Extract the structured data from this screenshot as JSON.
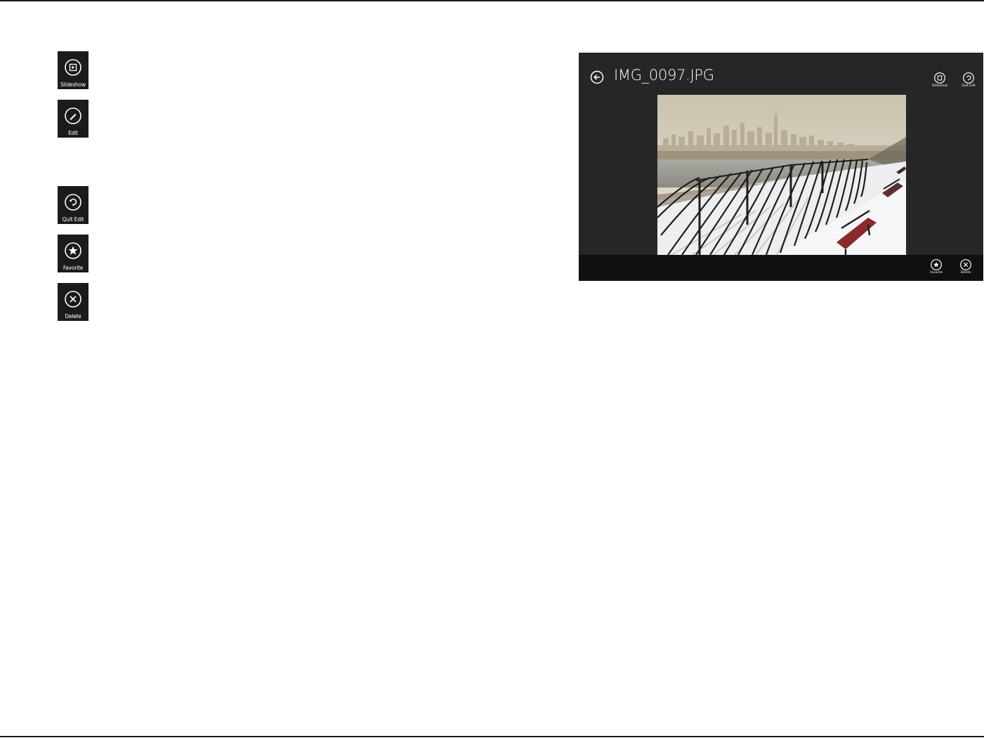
{
  "legend": [
    {
      "icon": "slideshow-icon",
      "label": "Slideshow"
    },
    {
      "icon": "edit-icon",
      "label": "Edit"
    },
    {
      "icon": "quit-edit-icon",
      "label": "Quit Edit"
    },
    {
      "icon": "favorite-icon",
      "label": "Favorite"
    },
    {
      "icon": "delete-icon",
      "label": "Delete"
    }
  ],
  "app": {
    "title": "IMG_0097.JPG",
    "top_buttons": [
      "Slideshow",
      "Quit Edit"
    ],
    "bottom_buttons": [
      "Favorite",
      "Delete"
    ],
    "colors": {
      "background": "#262626",
      "appbar": "#0e0e0e",
      "text": "#ffffff"
    }
  }
}
